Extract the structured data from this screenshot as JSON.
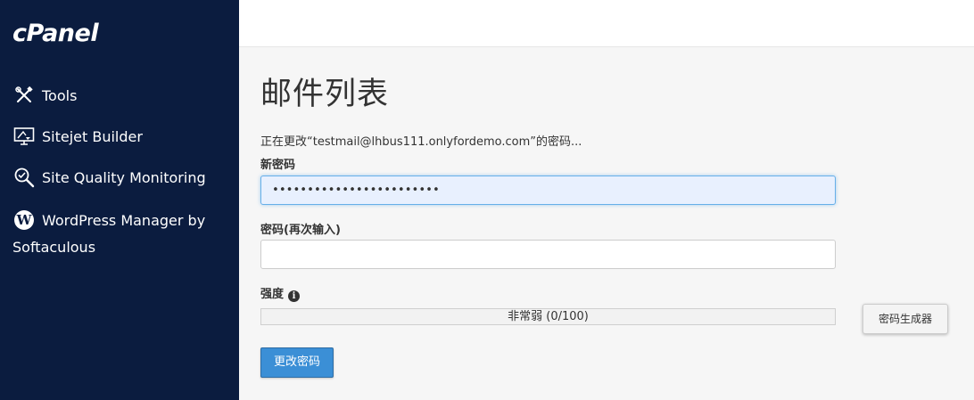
{
  "sidebar": {
    "logo": "cPanel",
    "items": [
      {
        "label": "Tools",
        "icon": "tools-icon"
      },
      {
        "label": "Sitejet Builder",
        "icon": "monitor-icon"
      },
      {
        "label": "Site Quality Monitoring",
        "icon": "search-icon"
      },
      {
        "label_line1": "WordPress Manager by",
        "label_line2": "Softaculous",
        "icon": "wordpress-icon"
      }
    ]
  },
  "main": {
    "title": "邮件列表",
    "changing_text": "正在更改“testmail@lhbus111.onlyfordemo.com”的密码...",
    "new_password_label": "新密码",
    "new_password_value": "••••••••••••••••••••••••",
    "confirm_password_label": "密码(再次输入)",
    "confirm_password_value": "",
    "strength_label": "强度",
    "strength_text": "非常弱 (0/100)",
    "strength_value": 0,
    "generator_button": "密码生成器",
    "submit_button": "更改密码"
  },
  "colors": {
    "sidebar_bg": "#0b1c3f",
    "primary": "#3b8fd6",
    "focus": "#66afe9"
  }
}
